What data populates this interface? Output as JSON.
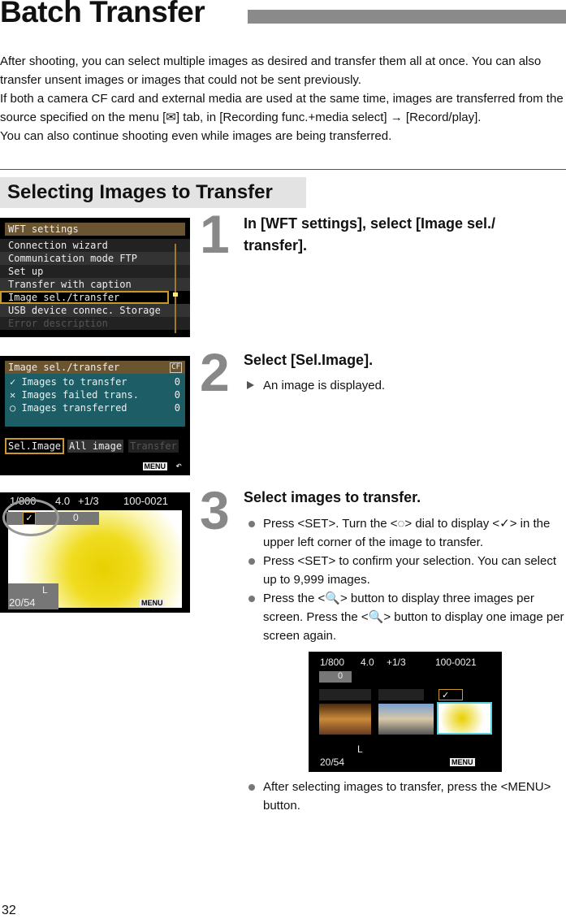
{
  "title": "Batch Transfer",
  "intro": [
    "After shooting, you can select multiple images as desired and transfer them all at once. You can also transfer unsent images or images that could not be sent previously.",
    "If both a camera CF card and external media are used at the same time, images are transferred from the source specified on the menu [✉] tab, in [Recording func.+media select] → [Record/play].",
    "You can also continue shooting even while images are being transferred."
  ],
  "section": "Selecting Images to Transfer",
  "screen1": {
    "title": "WFT settings",
    "items": [
      "Connection wizard",
      "Communication mode FTP",
      "Set up",
      "Transfer with caption",
      "Image sel./transfer",
      "USB device connec. Storage",
      "Error description"
    ]
  },
  "screen2": {
    "title": "Image sel./transfer",
    "badge": "CF",
    "rows": [
      {
        "icon": "✓",
        "label": "Images to transfer",
        "count": "0"
      },
      {
        "icon": "✕",
        "label": "Images failed trans.",
        "count": "0"
      },
      {
        "icon": "○",
        "label": "Images transferred",
        "count": "0"
      }
    ],
    "buttons": [
      "Sel.Image",
      "All image",
      "Transfer"
    ],
    "menu": "MENU"
  },
  "screen3": {
    "shutter": "1/800",
    "aperture": "4.0",
    "exposure": "+1/3",
    "file": "100-0021",
    "copies": "0",
    "quality": "L",
    "counter": "20/54",
    "menu": "MENU"
  },
  "steps": [
    {
      "num": "1",
      "title": "In [WFT settings], select [Image sel./ transfer]."
    },
    {
      "num": "2",
      "title": "Select [Sel.Image].",
      "note": "An image is displayed."
    },
    {
      "num": "3",
      "title": "Select images to transfer.",
      "bullets": [
        "Press <SET>. Turn the <◌> dial to display <✓> in the upper left corner of the image to transfer.",
        "Press <SET> to confirm your selection. You can select up to 9,999 images.",
        "Press the <🔍> button to display three images per screen. Press the <🔍> button to display one image per screen again."
      ],
      "last": "After selecting images to transfer, press the <MENU> button."
    }
  ],
  "page_number": "32"
}
